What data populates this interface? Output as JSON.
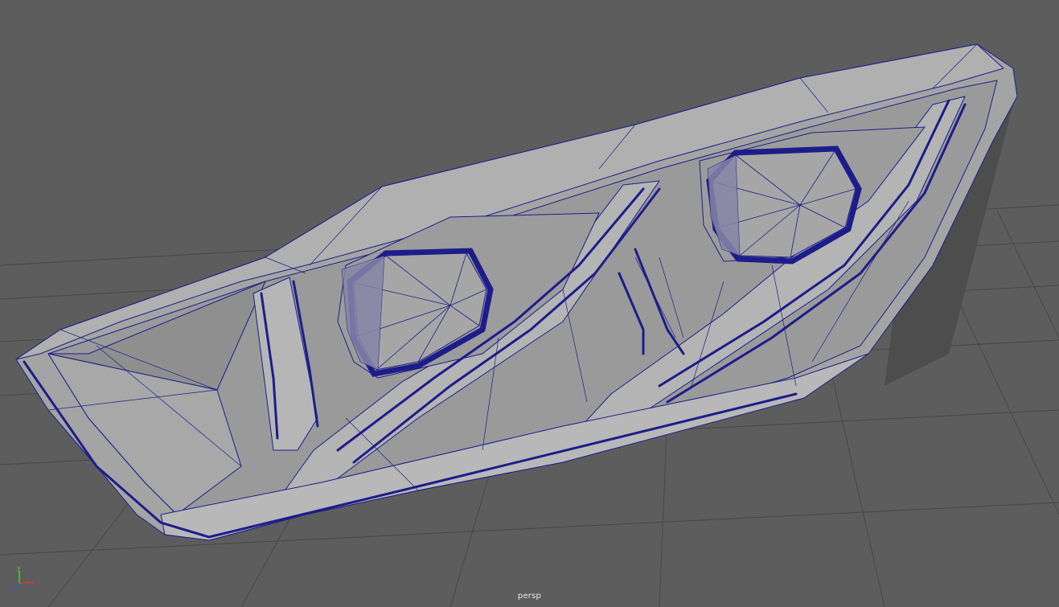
{
  "viewport": {
    "camera_name": "persp",
    "background_color": "#5d5d5d",
    "grid_color": "#444444",
    "mesh_color": "#a4a4a4",
    "wire_color": "#1d1d8a",
    "shadow_color": "#4a4a4a"
  },
  "axis_gizmo": {
    "x_label": "x",
    "y_label": "y",
    "z_label": "z",
    "x_color": "#d33a3a",
    "y_color": "#3ad33a",
    "z_color": "#3a5ad3"
  }
}
